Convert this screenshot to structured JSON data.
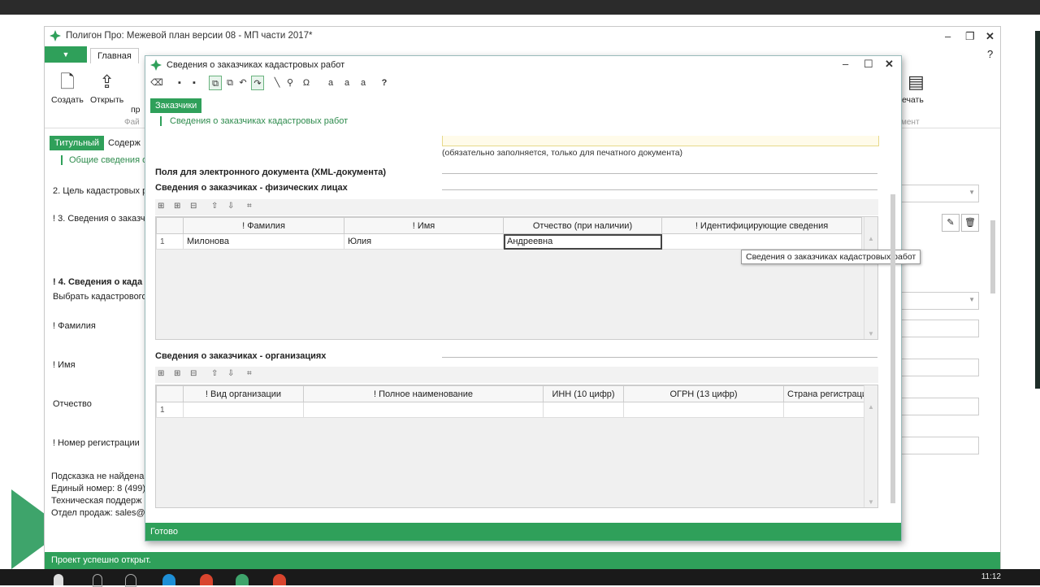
{
  "main_window": {
    "title": "Полигон Про: Межевой план версии 08 - МП части 2017*",
    "file_menu": "▼",
    "tab_home": "Главная",
    "ribbon": {
      "create": "Создать",
      "open": "Открыть",
      "partial_label": "пр",
      "file_group": "Фай",
      "print": "ечать",
      "doc_group": "мент"
    },
    "doc_tabs": {
      "title_tab": "Титульный",
      "content_tab": "Содерж"
    },
    "sub_link": "Общие сведения о",
    "labels": {
      "purpose": "2. Цель кадастровых р",
      "customers": "! 3. Сведения о заказч",
      "engineer_section": "! 4. Сведения о када",
      "choose_engineer": "Выбрать кадастрового",
      "surname": "! Фамилия",
      "name": "! Имя",
      "patronymic": "Отчество",
      "reg_number": "! Номер регистрации"
    },
    "hint": {
      "line1": "Подсказка не найдена",
      "line2": "Единый номер: 8 (499)",
      "line3": "Техническая поддерж",
      "line4": "Отдел продаж: sales@"
    },
    "status": "Проект успешно открыт."
  },
  "dialog": {
    "title": "Сведения о заказчиках кадастровых работ",
    "tab": "Заказчики",
    "link": "Сведения о заказчиках кадастровых работ",
    "print_note": "(обязательно заполняется, только для печатного документа)",
    "xml_section": "Поля для электронного документа (XML-документа)",
    "physical_section": "Сведения о заказчиках - физических лицах",
    "physical_columns": [
      "! Фамилия",
      "! Имя",
      "Отчество (при наличии)",
      "! Идентифицирующие сведения"
    ],
    "physical_rows": [
      {
        "num": "1",
        "surname": "Милонова",
        "name": "Юлия",
        "patronymic": "Андреевна",
        "ident": ""
      }
    ],
    "org_section": "Сведения о заказчиках - организациях",
    "org_columns": [
      "! Вид организации",
      "! Полное наименование",
      "ИНН (10 цифр)",
      "ОГРН (13 цифр)",
      "Страна регистраци"
    ],
    "org_rows": [
      {
        "num": "1"
      }
    ],
    "tooltip": "Сведения о заказчиках кадастровых работ",
    "status": "Готово"
  },
  "taskbar": {
    "time": "11:12"
  },
  "colors": {
    "accent": "#2fa05a",
    "link": "#2f8c4e"
  }
}
